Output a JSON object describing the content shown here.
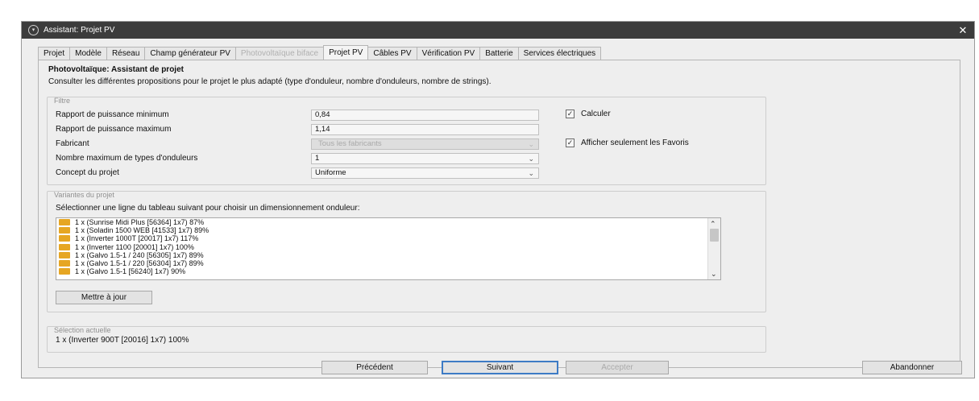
{
  "window": {
    "title": "Assistant: Projet PV",
    "close_symbol": "✕"
  },
  "tabs": [
    {
      "label": "Projet",
      "state": "normal"
    },
    {
      "label": "Modèle",
      "state": "normal"
    },
    {
      "label": "Réseau",
      "state": "normal"
    },
    {
      "label": "Champ générateur PV",
      "state": "normal"
    },
    {
      "label": "Photovoltaïque biface",
      "state": "disabled"
    },
    {
      "label": "Projet PV",
      "state": "active"
    },
    {
      "label": "Câbles PV",
      "state": "normal"
    },
    {
      "label": "Vérification PV",
      "state": "normal"
    },
    {
      "label": "Batterie",
      "state": "normal"
    },
    {
      "label": "Services électriques",
      "state": "normal"
    }
  ],
  "content": {
    "heading": "Photovoltaïque: Assistant de projet",
    "subheading": "Consulter les différentes propositions pour le projet le plus adapté (type d'onduleur, nombre d'onduleurs, nombre de strings)."
  },
  "filter": {
    "title": "Filtre",
    "min_ratio_label": "Rapport de puissance minimum",
    "min_ratio_value": "0,84",
    "max_ratio_label": "Rapport de puissance maximum",
    "max_ratio_value": "1,14",
    "manufacturer_label": "Fabricant",
    "manufacturer_value": "Tous les fabricants",
    "max_types_label": "Nombre maximum de types d'onduleurs",
    "max_types_value": "1",
    "concept_label": "Concept du projet",
    "concept_value": "Uniforme",
    "calculate_label": "Calculer",
    "calculate_checked": true,
    "favorites_label": "Afficher seulement les Favoris",
    "favorites_checked": true
  },
  "variants": {
    "title": "Variantes du projet",
    "hint": "Sélectionner une ligne du tableau suivant pour choisir un dimensionnement onduleur:",
    "items": [
      "1 x (Sunrise Midi Plus [56364] 1x7) 87%",
      "1 x (Soladin 1500 WEB [41533] 1x7) 89%",
      "1 x (Inverter 1000T [20017] 1x7) 117%",
      "1 x (Inverter 1100 [20001] 1x7) 100%",
      "1 x (Galvo 1.5-1 / 240 [56305] 1x7) 89%",
      "1 x (Galvo 1.5-1 / 220 [56304] 1x7) 89%",
      "1 x (Galvo 1.5-1 [56240] 1x7) 90%"
    ],
    "update_button": "Mettre à jour"
  },
  "selection": {
    "title": "Sélection actuelle",
    "value": "1 x (Inverter 900T [20016] 1x7) 100%"
  },
  "footer": {
    "previous": "Précédent",
    "next": "Suivant",
    "accept": "Accepter",
    "abort": "Abandonner"
  },
  "icons": {
    "check": "✓",
    "chevron": "⌄",
    "scroll_up": "⌃",
    "scroll_down": "⌄",
    "folder_color": "#e6a623"
  }
}
